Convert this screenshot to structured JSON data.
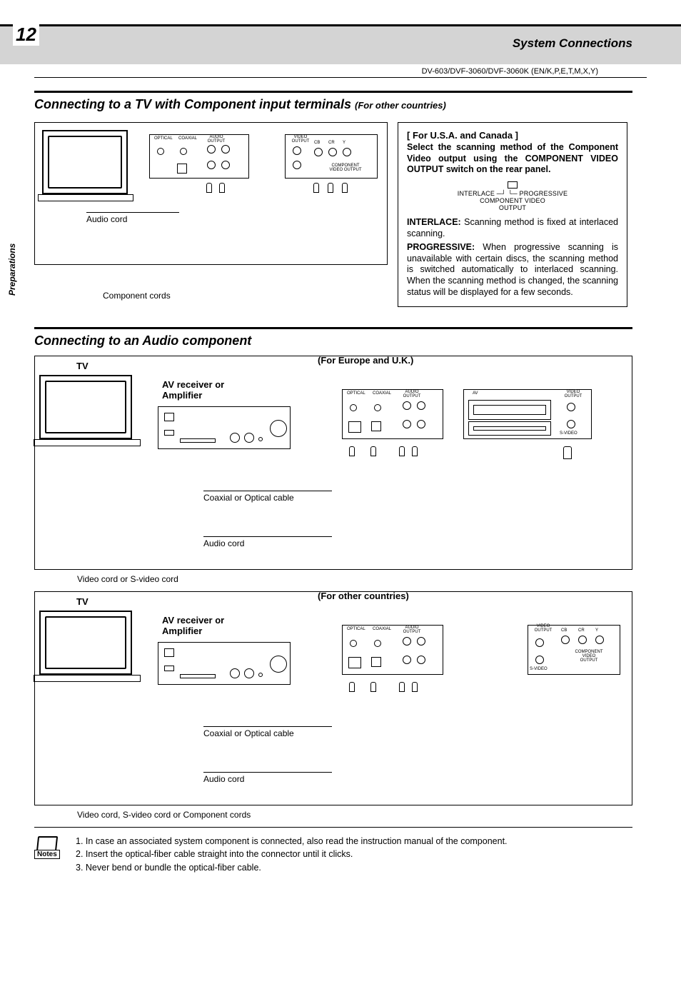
{
  "page_number": "12",
  "section_title": "System Connections",
  "model_line": "DV-603/DVF-3060/DVF-3060K (EN/K,P,E,T,M,X,Y)",
  "side_tab": "Preparations",
  "heading1_main": "Connecting to a TV with Component input terminals",
  "heading1_sub": "(For other countries)",
  "heading2": "Connecting to an Audio component",
  "diagram1": {
    "audio_cord": "Audio cord",
    "component_cords": "Component cords"
  },
  "info_box": {
    "header": "[ For U.S.A. and Canada ]",
    "lead": "Select the scanning method of the Component Video output using the COMPONENT VIDEO OUTPUT switch on the rear panel.",
    "switch_left": "INTERLACE",
    "switch_right": "PROGRESSIVE",
    "switch_label1": "COMPONENT VIDEO",
    "switch_label2": "OUTPUT",
    "interlace_label": "INTERLACE:",
    "interlace_text": " Scanning method is fixed at interlaced scanning.",
    "progressive_label": "PROGRESSIVE:",
    "progressive_text": " When progressive scanning is unavailable with certain discs, the scanning method is switched automatically to interlaced scanning. When the scanning method is changed, the scanning status will be displayed for a few seconds."
  },
  "audio_section": {
    "region_eu": "(For Europe and U.K.)",
    "region_other": "(For other countries)",
    "tv": "TV",
    "avamp": "AV receiver or Amplifier",
    "coax_optical": "Coaxial or Optical cable",
    "audio_cord": "Audio cord",
    "below_eu": "Video cord or S-video cord",
    "below_other": "Video cord, S-video cord or Component cords"
  },
  "notes": {
    "label": "Notes",
    "n1": "1.  In case an associated system component is connected, also read the instruction manual of the component.",
    "n2": "2.  Insert the optical-fiber cable straight into the connector until it clicks.",
    "n3": "3.  Never bend or bundle the optical-fiber cable."
  }
}
